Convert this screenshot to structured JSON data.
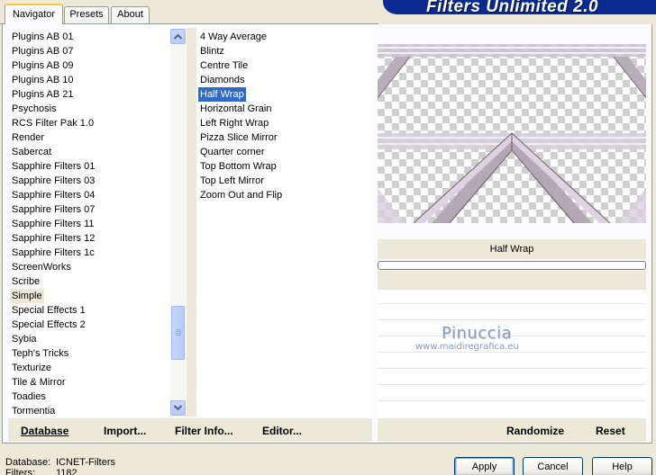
{
  "tabs": [
    {
      "label": "Navigator",
      "active": true
    },
    {
      "label": "Presets",
      "active": false
    },
    {
      "label": "About",
      "active": false
    }
  ],
  "banner": {
    "title": "Filters Unlimited 2.0"
  },
  "categories": [
    "Plugins AB 01",
    "Plugins AB 07",
    "Plugins AB 09",
    "Plugins AB 10",
    "Plugins AB 21",
    "Psychosis",
    "RCS Filter Pak 1.0",
    "Render",
    "Sabercat",
    "Sapphire Filters 01",
    "Sapphire Filters 03",
    "Sapphire Filters 04",
    "Sapphire Filters 07",
    "Sapphire Filters 11",
    "Sapphire Filters 12",
    "Sapphire Filters 1c",
    "ScreenWorks",
    "Scribe",
    "Simple",
    "Special Effects 1",
    "Special Effects 2",
    "Sybia",
    "Teph's Tricks",
    "Texturize",
    "Tile & Mirror",
    "Toadies",
    "Tormentia"
  ],
  "selected_category": "Simple",
  "filters": [
    "4 Way Average",
    "Blintz",
    "Centre Tile",
    "Diamonds",
    "Half Wrap",
    "Horizontal Grain",
    "Left Right Wrap",
    "Pizza Slice Mirror",
    "Quarter corner",
    "Top Bottom Wrap",
    "Top Left Mirror",
    "Zoom Out and Flip"
  ],
  "selected_filter": "Half Wrap",
  "preview": {
    "filter_name": "Half Wrap"
  },
  "watermark": {
    "name": "Pinuccia",
    "url": "www.maidiregrafica.eu"
  },
  "toolbar": {
    "database": "Database",
    "import": "Import...",
    "filter_info": "Filter Info...",
    "editor": "Editor...",
    "randomize": "Randomize",
    "reset": "Reset"
  },
  "status": {
    "database_label": "Database:",
    "database_value": "ICNET-Filters",
    "filters_label": "Filters:",
    "filters_value": "1182"
  },
  "buttons": {
    "apply": "Apply",
    "cancel": "Cancel",
    "help": "Help"
  },
  "colors": {
    "selection": "#316ac5",
    "banner": "#0a2a8f"
  }
}
